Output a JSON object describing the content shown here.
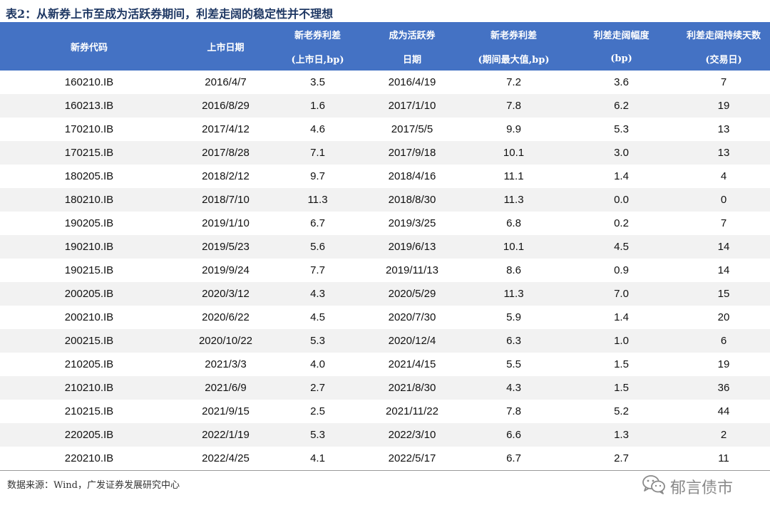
{
  "title": "表2：从新券上市至成为活跃券期间，利差走阔的稳定性并不理想",
  "headers": {
    "col1": "新券代码",
    "col2": "上市日期",
    "col3_l1": "新老券利差",
    "col3_l2": "(上市日,bp)",
    "col4_l1": "成为活跃券",
    "col4_l2": "日期",
    "col5_l1": "新老券利差",
    "col5_l2": "(期间最大值,bp)",
    "col6_l1": "利差走阔幅度",
    "col6_l2": "(bp)",
    "col7_l1": "利差走阔持续天数",
    "col7_l2": "(交易日)"
  },
  "rows": [
    [
      "160210.IB",
      "2016/4/7",
      "3.5",
      "2016/4/19",
      "7.2",
      "3.6",
      "7"
    ],
    [
      "160213.IB",
      "2016/8/29",
      "1.6",
      "2017/1/10",
      "7.8",
      "6.2",
      "19"
    ],
    [
      "170210.IB",
      "2017/4/12",
      "4.6",
      "2017/5/5",
      "9.9",
      "5.3",
      "13"
    ],
    [
      "170215.IB",
      "2017/8/28",
      "7.1",
      "2017/9/18",
      "10.1",
      "3.0",
      "13"
    ],
    [
      "180205.IB",
      "2018/2/12",
      "9.7",
      "2018/4/16",
      "11.1",
      "1.4",
      "4"
    ],
    [
      "180210.IB",
      "2018/7/10",
      "11.3",
      "2018/8/30",
      "11.3",
      "0.0",
      "0"
    ],
    [
      "190205.IB",
      "2019/1/10",
      "6.7",
      "2019/3/25",
      "6.8",
      "0.2",
      "7"
    ],
    [
      "190210.IB",
      "2019/5/23",
      "5.6",
      "2019/6/13",
      "10.1",
      "4.5",
      "14"
    ],
    [
      "190215.IB",
      "2019/9/24",
      "7.7",
      "2019/11/13",
      "8.6",
      "0.9",
      "14"
    ],
    [
      "200205.IB",
      "2020/3/12",
      "4.3",
      "2020/5/29",
      "11.3",
      "7.0",
      "15"
    ],
    [
      "200210.IB",
      "2020/6/22",
      "4.5",
      "2020/7/30",
      "5.9",
      "1.4",
      "20"
    ],
    [
      "200215.IB",
      "2020/10/22",
      "5.3",
      "2020/12/4",
      "6.3",
      "1.0",
      "6"
    ],
    [
      "210205.IB",
      "2021/3/3",
      "4.0",
      "2021/4/15",
      "5.5",
      "1.5",
      "19"
    ],
    [
      "210210.IB",
      "2021/6/9",
      "2.7",
      "2021/8/30",
      "4.3",
      "1.5",
      "36"
    ],
    [
      "210215.IB",
      "2021/9/15",
      "2.5",
      "2021/11/22",
      "7.8",
      "5.2",
      "44"
    ],
    [
      "220205.IB",
      "2022/1/19",
      "5.3",
      "2022/3/10",
      "6.6",
      "1.3",
      "2"
    ],
    [
      "220210.IB",
      "2022/4/25",
      "4.1",
      "2022/5/17",
      "6.7",
      "2.7",
      "11"
    ]
  ],
  "source": "数据来源：Wind，广发证券发展研究中心",
  "watermark": {
    "icon": "wechat-icon",
    "text": "郁言债市"
  }
}
